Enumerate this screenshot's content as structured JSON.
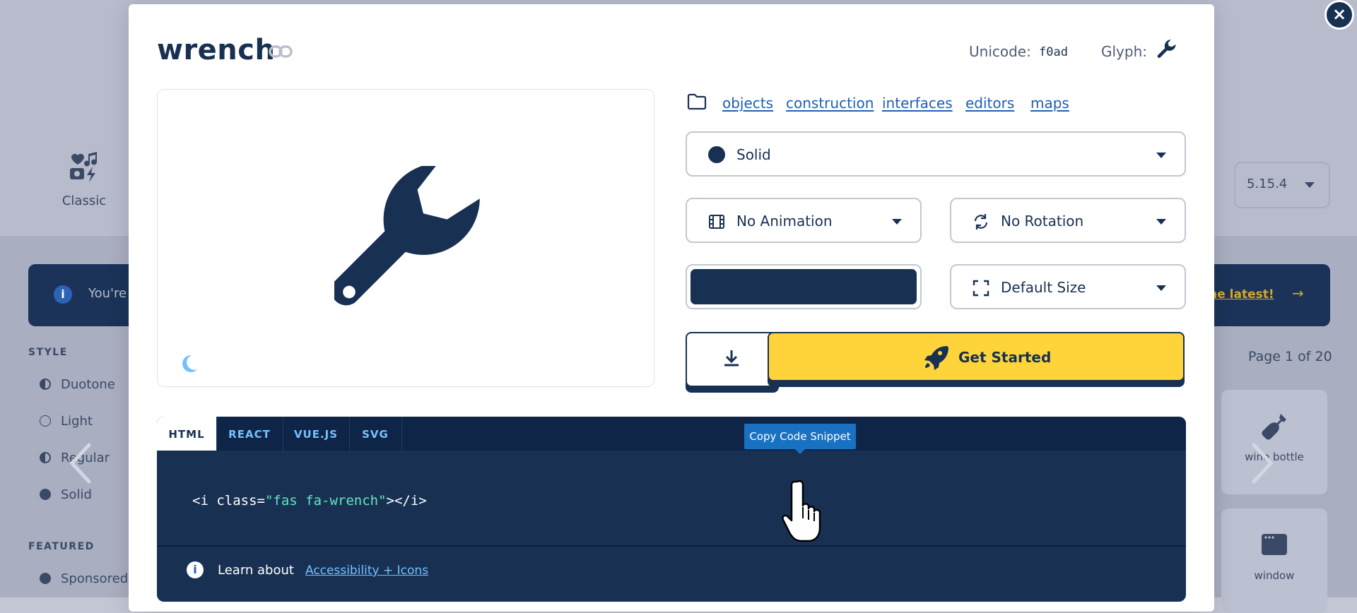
{
  "background": {
    "classic_label": "Classic",
    "version": "5.15.4",
    "banner_text": "You're",
    "banner_cta": "the latest!",
    "page_indicator": "Page 1 of 20",
    "style_heading": "STYLE",
    "style_options": [
      "Duotone",
      "Light",
      "Regular",
      "Solid"
    ],
    "featured_heading": "FEATURED",
    "featured_options": [
      "Sponsored"
    ],
    "cards": [
      "wine bottle",
      "window"
    ]
  },
  "modal": {
    "close_label": "×",
    "icon_name": "wrench",
    "unicode_label": "Unicode:",
    "unicode_value": "f0ad",
    "glyph_label": "Glyph:",
    "categories": [
      "objects",
      "construction",
      "interfaces",
      "editors",
      "maps"
    ],
    "style_select": "Solid",
    "animation_select": "No Animation",
    "rotation_select": "No Rotation",
    "size_select": "Default Size",
    "get_started_label": "Get Started",
    "code_tabs": [
      "HTML",
      "REACT",
      "VUE.JS",
      "SVG"
    ],
    "active_tab": "HTML",
    "snippet": {
      "open": "<i class=",
      "class_string": "\"fas fa-wrench\"",
      "close": "></i>"
    },
    "tooltip": "Copy Code Snippet",
    "learn_prefix": "Learn about",
    "learn_link": "Accessibility + Icons"
  },
  "colors": {
    "navy": "#183153",
    "yellow": "#ffd43b",
    "link_blue": "#1e5fb4",
    "moon_blue": "#74c0fc"
  }
}
